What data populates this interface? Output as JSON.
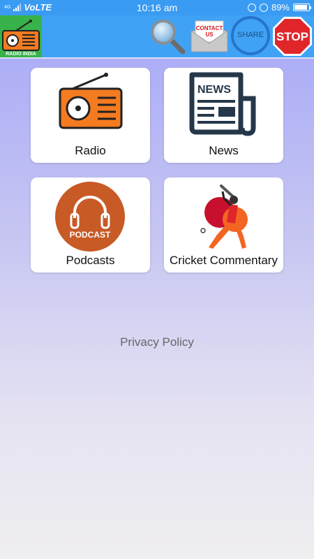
{
  "status_bar": {
    "network": "4G",
    "carrier": "VoLTE",
    "time": "10:16 am",
    "battery_text": "89%",
    "battery_level": 0.89
  },
  "toolbar": {
    "logo_text": "RADIO INDIA",
    "contact_label_line1": "CONTACT",
    "contact_label_line2": "US",
    "share_label": "SHARE",
    "stop_label": "STOP"
  },
  "cards": [
    {
      "label": "Radio",
      "icon": "radio-icon"
    },
    {
      "label": "News",
      "icon": "newspaper-icon"
    },
    {
      "label": "Podcasts",
      "icon": "podcast-icon",
      "icon_text": "PODCAST"
    },
    {
      "label": "Cricket Commentary",
      "icon": "cricket-batsman-icon"
    }
  ],
  "footer": {
    "privacy_label": "Privacy Policy"
  },
  "colors": {
    "status_bar": "#3a9bf2",
    "toolbar": "#3fa2f5",
    "radio_orange": "#f47b20",
    "podcast_orange": "#c85a26",
    "news_navy": "#25384a"
  }
}
